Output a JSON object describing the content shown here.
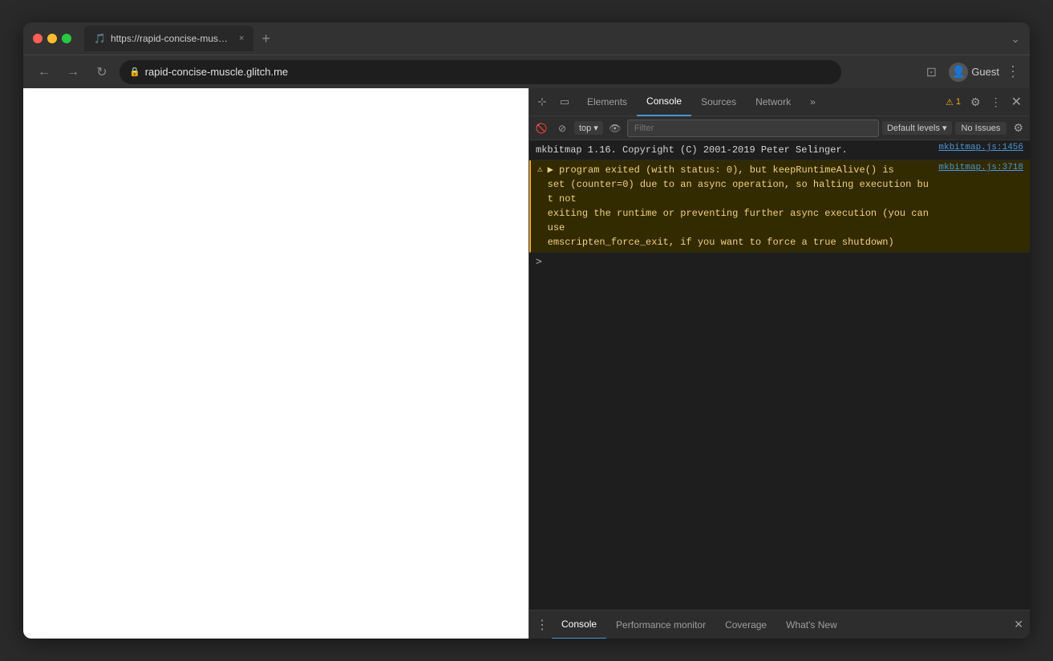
{
  "browser": {
    "tab_title": "https://rapid-concise-muscle.g...",
    "tab_icon": "🎵",
    "url": "rapid-concise-muscle.glitch.me",
    "profile_name": "Guest"
  },
  "devtools": {
    "tabs": [
      {
        "label": "Elements",
        "active": false
      },
      {
        "label": "Console",
        "active": true
      },
      {
        "label": "Sources",
        "active": false
      },
      {
        "label": "Network",
        "active": false
      }
    ],
    "warning_count": "1",
    "console_toolbar": {
      "top_value": "top",
      "filter_placeholder": "Filter",
      "default_levels": "Default levels",
      "no_issues": "No Issues"
    },
    "console_messages": [
      {
        "type": "info",
        "text": "mkbitmap 1.16. Copyright (C) 2001-2019 Peter Selinger.",
        "source": "mkbitmap.js:1456"
      },
      {
        "type": "warning",
        "text": "▶ program exited (with status: 0), but keepRuntimeAlive() is\nset (counter=0) due to an async operation, so halting execution but not\nexiting the runtime or preventing further async execution (you can use\nemscripten_force_exit, if you want to force a true shutdown)",
        "source": "mkbitmap.js:3718"
      }
    ],
    "console_prompt": ">",
    "bottom_tabs": [
      {
        "label": "Console",
        "active": true
      },
      {
        "label": "Performance monitor",
        "active": false
      },
      {
        "label": "Coverage",
        "active": false
      },
      {
        "label": "What's New",
        "active": false
      }
    ]
  }
}
